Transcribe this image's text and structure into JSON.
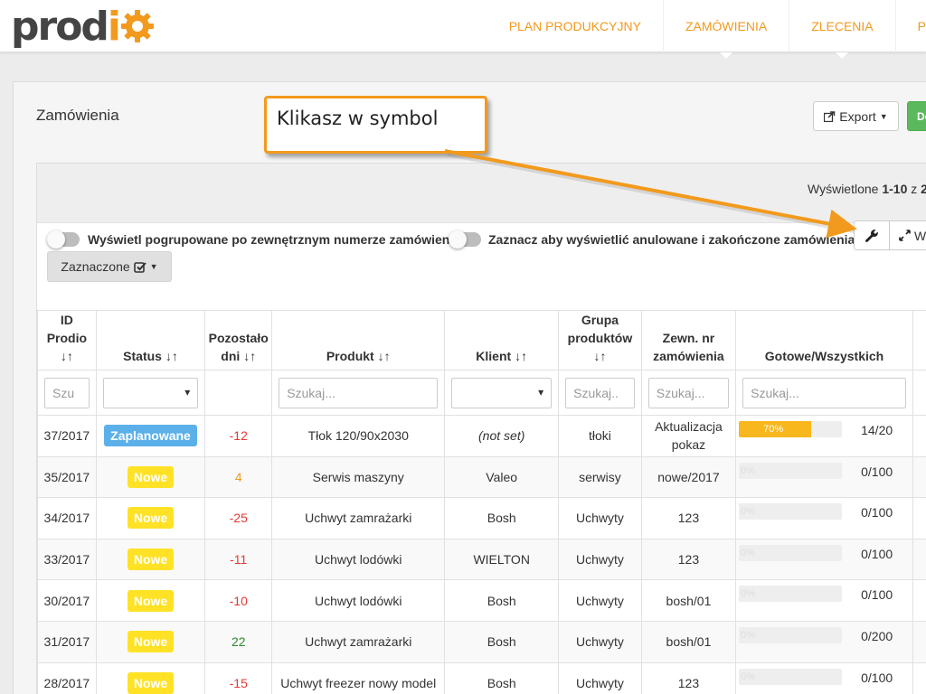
{
  "logo": {
    "part1": "prod",
    "part2": "i",
    "gear_icon": "gear-icon"
  },
  "nav": {
    "items": [
      {
        "label": "PLAN PRODUKCYJNY"
      },
      {
        "label": "ZAMÓWIENIA"
      },
      {
        "label": "ZLECENIA"
      },
      {
        "label": "P"
      }
    ]
  },
  "page": {
    "title": "Zamówienia",
    "export_label": "Export",
    "add_label": "Do"
  },
  "summary": {
    "prefix": "Wyświetlone ",
    "range": "1-10",
    "middle": " z ",
    "total": "2"
  },
  "toggles": {
    "grouped_label": "Wyświetl pogrupowane po zewnętrznym numerze zamówienia",
    "cancelled_label": "Zaznacz aby wyświetlić anulowane i zakończone zamówienia"
  },
  "toolbar": {
    "expand_label": "W",
    "selected_label": "Zaznaczone"
  },
  "table": {
    "headers": {
      "id": "ID Prodio",
      "status": "Status",
      "remaining": "Pozostało dni",
      "product": "Produkt",
      "client": "Klient",
      "group": "Grupa produktów",
      "ext": "Zewn. nr zamówienia",
      "ready": "Gotowe/Wszystkich"
    },
    "sort_icon": "sort-icon",
    "filters": {
      "id_placeholder": "Szu",
      "product_placeholder": "Szukaj...",
      "group_placeholder": "Szukaj..",
      "ext_placeholder": "Szukaj...",
      "ready_placeholder": "Szukaj..."
    },
    "rows": [
      {
        "id": "37/2017",
        "status": "Zaplanowane",
        "days": "-12",
        "product": "Tłok 120/90x2030",
        "client": "(not set)",
        "group": "tłoki",
        "ext": "Aktualizacja pokaz",
        "progress_label": "70%",
        "progress": 70,
        "count": "14/20"
      },
      {
        "id": "35/2017",
        "status": "Nowe",
        "days": "4",
        "product": "Serwis maszyny",
        "client": "Valeo",
        "group": "serwisy",
        "ext": "nowe/2017",
        "progress_label": "0%",
        "progress": 0,
        "count": "0/100"
      },
      {
        "id": "34/2017",
        "status": "Nowe",
        "days": "-25",
        "product": "Uchwyt zamrażarki",
        "client": "Bosh",
        "group": "Uchwyty",
        "ext": "123",
        "progress_label": "0%",
        "progress": 0,
        "count": "0/100"
      },
      {
        "id": "33/2017",
        "status": "Nowe",
        "days": "-11",
        "product": "Uchwyt lodówki",
        "client": "WIELTON",
        "group": "Uchwyty",
        "ext": "123",
        "progress_label": "0%",
        "progress": 0,
        "count": "0/100"
      },
      {
        "id": "30/2017",
        "status": "Nowe",
        "days": "-10",
        "product": "Uchwyt lodówki",
        "client": "Bosh",
        "group": "Uchwyty",
        "ext": "bosh/01",
        "progress_label": "0%",
        "progress": 0,
        "count": "0/100"
      },
      {
        "id": "31/2017",
        "status": "Nowe",
        "days": "22",
        "product": "Uchwyt zamrażarki",
        "client": "Bosh",
        "group": "Uchwyty",
        "ext": "bosh/01",
        "progress_label": "0%",
        "progress": 0,
        "count": "0/200"
      },
      {
        "id": "28/2017",
        "status": "Nowe",
        "days": "-15",
        "product": "Uchwyt freezer nowy model",
        "client": "Bosh",
        "group": "Uchwyty",
        "ext": "123",
        "progress_label": "0%",
        "progress": 0,
        "count": "0/100"
      }
    ]
  },
  "annotation": {
    "text": "Klikasz w symbol"
  },
  "colors": {
    "brand_orange": "#f29a1d",
    "planned_badge": "#5bb0e9",
    "new_badge": "#ffe225",
    "negative_days": "#e53935",
    "positive_days_orange": "#f29a1d",
    "positive_days_green": "#2e8b2e",
    "progress_fill": "#f7b71d"
  }
}
